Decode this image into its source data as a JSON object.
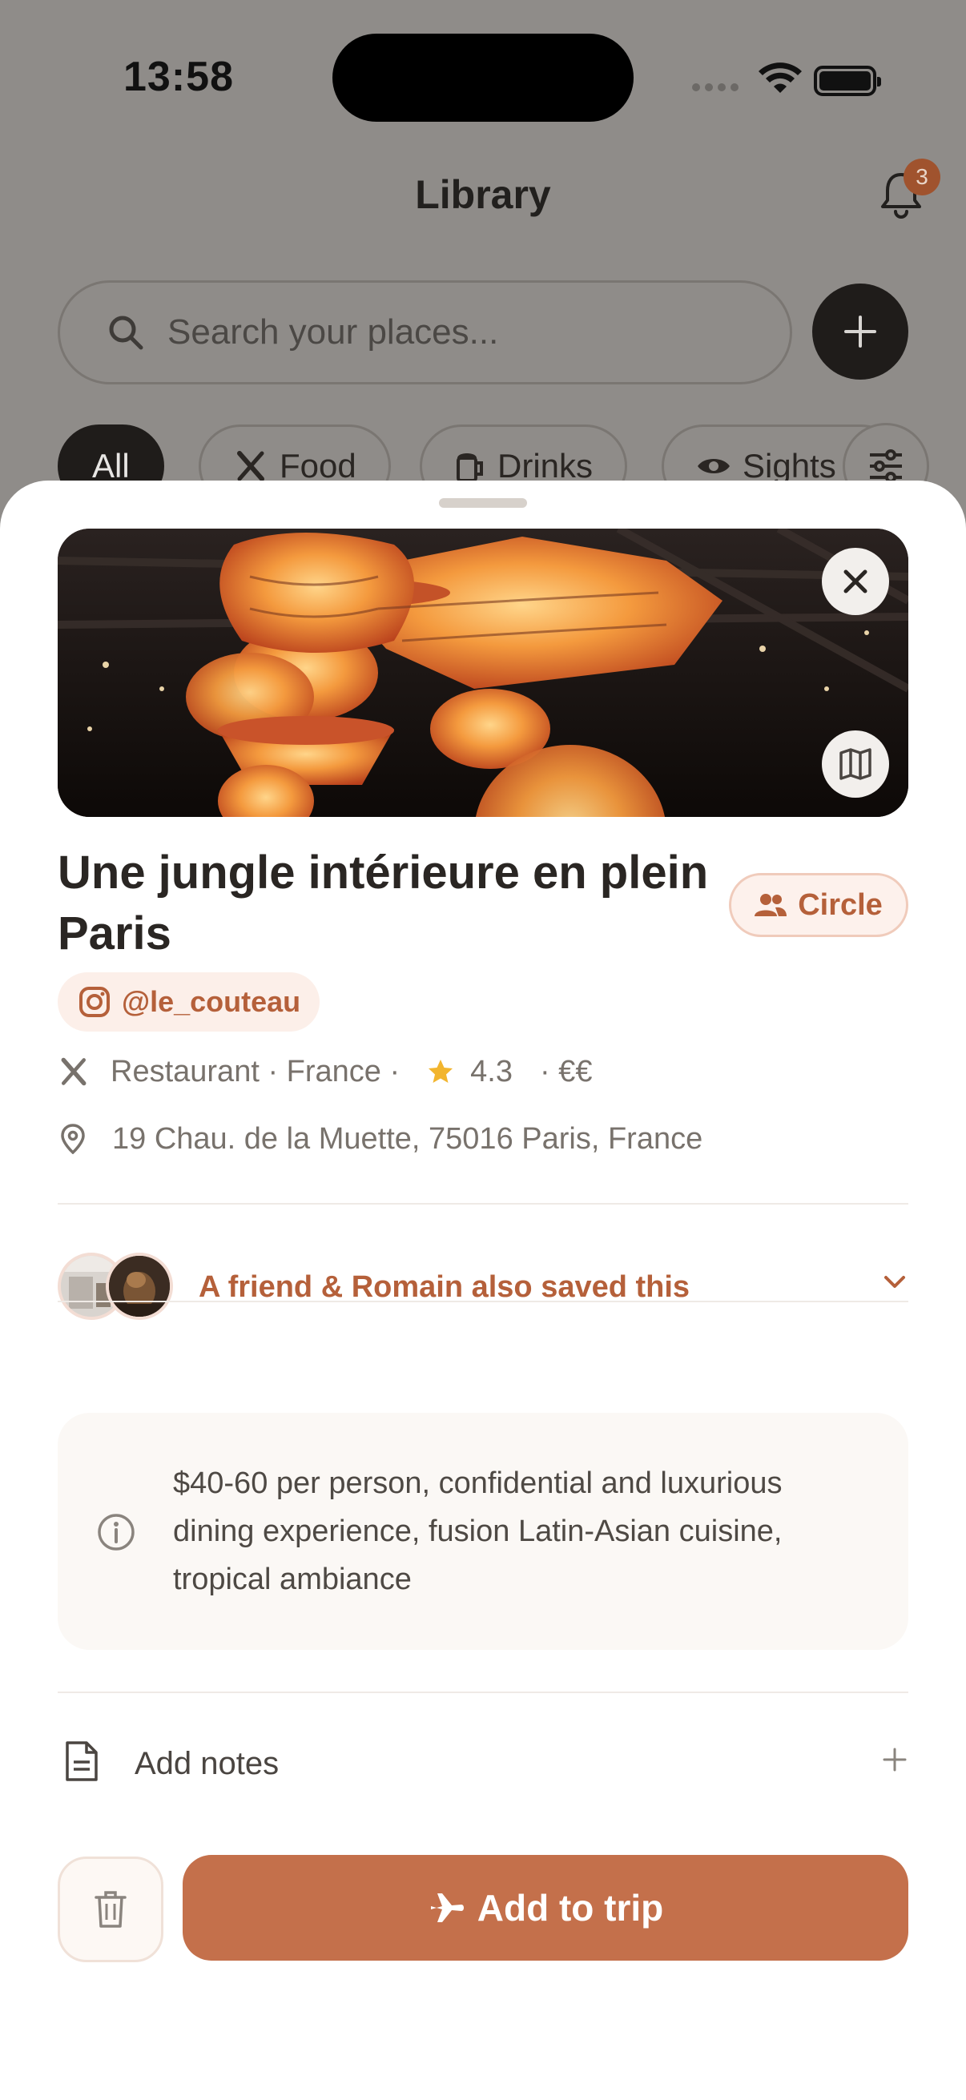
{
  "status_bar": {
    "time": "13:58"
  },
  "library": {
    "title": "Library",
    "notification_count": "3",
    "search_placeholder": "Search your places...",
    "chips": [
      {
        "label": "All",
        "icon": "none",
        "active": true
      },
      {
        "label": "Food",
        "icon": "utensils-icon",
        "active": false
      },
      {
        "label": "Drinks",
        "icon": "beer-mug-icon",
        "active": false
      },
      {
        "label": "Sights",
        "icon": "eye-icon",
        "active": false
      }
    ]
  },
  "place": {
    "title": "Une jungle intérieure en plein Paris",
    "visibility_badge": "Circle",
    "source_handle": "@le_couteau",
    "category": "Restaurant · France ·",
    "rating": "4.3",
    "price": "· €€",
    "address": "19 Chau. de la Muette, 75016 Paris, France",
    "friends_text": "A friend & Romain also saved this",
    "description": "$40-60 per person, confidential and luxurious dining experience, fusion Latin-Asian cuisine, tropical ambiance",
    "notes_label": "Add notes",
    "primary_action": "Add to trip"
  },
  "colors": {
    "accent": "#c4704b",
    "accent_text": "#b5603a",
    "star": "#f2b52e",
    "dark": "#1f1c1a"
  }
}
